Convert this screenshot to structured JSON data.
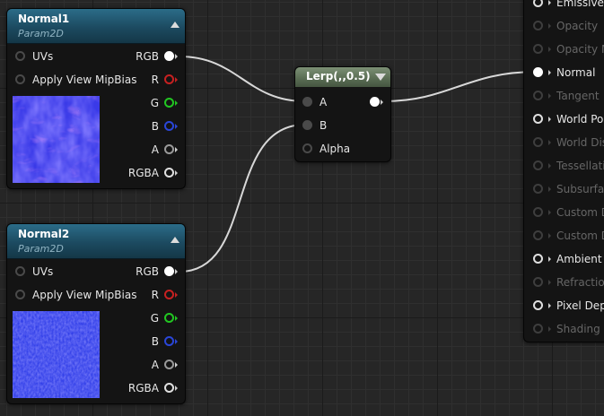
{
  "colors": {
    "header_param": "#1c4a60",
    "header_lerp": "#586b52",
    "wire": "#d8d8d8",
    "pin_r": "#c72121",
    "pin_g": "#22c622",
    "pin_b": "#2a46d8",
    "normal_map": "#2f3de8"
  },
  "nodes": {
    "normal1": {
      "title": "Normal1",
      "subtitle": "Param2D",
      "inputs": [
        "UVs",
        "Apply View MipBias"
      ],
      "outputs": [
        "RGB",
        "R",
        "G",
        "B",
        "A",
        "RGBA"
      ]
    },
    "normal2": {
      "title": "Normal2",
      "subtitle": "Param2D",
      "inputs": [
        "UVs",
        "Apply View MipBias"
      ],
      "outputs": [
        "RGB",
        "R",
        "G",
        "B",
        "A",
        "RGBA"
      ]
    },
    "lerp": {
      "title": "Lerp(,,0.5)",
      "inputs": [
        "A",
        "B",
        "Alpha"
      ]
    },
    "material": {
      "inputs": [
        {
          "label": "Emissive C",
          "enabled": true
        },
        {
          "label": "Opacity",
          "enabled": false
        },
        {
          "label": "Opacity Ma",
          "enabled": false
        },
        {
          "label": "Normal",
          "enabled": true,
          "connected": true
        },
        {
          "label": "Tangent",
          "enabled": false
        },
        {
          "label": "World Posi",
          "enabled": true
        },
        {
          "label": "World Disp",
          "enabled": false
        },
        {
          "label": "Tessellatio",
          "enabled": false
        },
        {
          "label": "Subsurface",
          "enabled": false
        },
        {
          "label": "Custom Da",
          "enabled": false
        },
        {
          "label": "Custom Da",
          "enabled": false
        },
        {
          "label": "Ambient Oc",
          "enabled": true
        },
        {
          "label": "Refraction",
          "enabled": false
        },
        {
          "label": "Pixel Depth",
          "enabled": true
        },
        {
          "label": "Shading M",
          "enabled": false
        }
      ]
    }
  }
}
